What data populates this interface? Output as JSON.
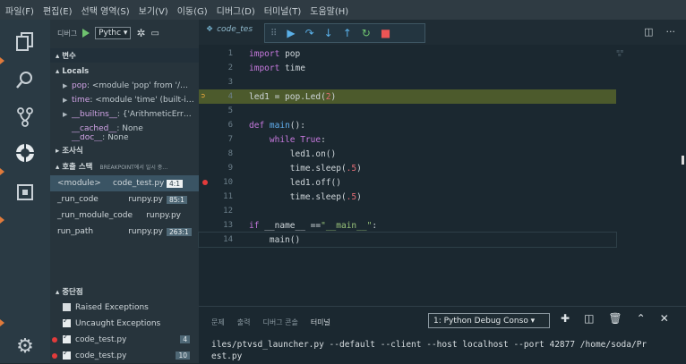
{
  "menubar": [
    "파일(F)",
    "편집(E)",
    "선택 영역(S)",
    "보기(V)",
    "이동(G)",
    "디버그(D)",
    "터미널(T)",
    "도움말(H)"
  ],
  "activity": {
    "icons": [
      "files-icon",
      "search-icon",
      "source-control-icon",
      "debug-icon",
      "extensions-icon",
      "settings-gear-icon"
    ]
  },
  "debug": {
    "label": "디버그",
    "config_select": "Pythc ▾"
  },
  "sections": {
    "variables": "▴ 변수",
    "locals": "▴ Locals",
    "watch": "▸ 조사식",
    "callstack": "▴ 호출 스택",
    "callstack_note": "BREAKPOINT에서 일시 중…",
    "breakpoints": "▴ 중단점"
  },
  "locals": [
    {
      "name": "pop",
      "value": ": <module 'pop' from '/…"
    },
    {
      "name": "time",
      "value": ": <module 'time' (built-i…"
    },
    {
      "name": "__builtins__",
      "value": ": {'ArithmeticErr…"
    },
    {
      "name": "__cached__",
      "value": ": None"
    },
    {
      "name": "__doc__",
      "value": ": None"
    }
  ],
  "callstack": [
    {
      "fn": "<module>",
      "file": "code_test.py",
      "line": "4:1"
    },
    {
      "fn": "_run_code",
      "file": "runpy.py",
      "line": "85:1"
    },
    {
      "fn": "_run_module_code",
      "file": "runpy.py",
      "line": ""
    },
    {
      "fn": "run_path",
      "file": "runpy.py",
      "line": "263:1"
    }
  ],
  "breakpoints": [
    {
      "label": "Raised Exceptions",
      "checked": false,
      "count": ""
    },
    {
      "label": "Uncaught Exceptions",
      "checked": true,
      "count": ""
    },
    {
      "label": "code_test.py",
      "checked": true,
      "count": "4"
    },
    {
      "label": "code_test.py",
      "checked": true,
      "count": "10"
    }
  ],
  "editor": {
    "tab": "code_tes",
    "lines": [
      "1",
      "2",
      "3",
      "4",
      "5",
      "6",
      "7",
      "8",
      "9",
      "10",
      "11",
      "12",
      "13",
      "14"
    ]
  },
  "panel": {
    "tabs": [
      "문제",
      "출력",
      "디버그 콘솔",
      "터미널"
    ],
    "terminal_select": "1: Python Debug Conso ▾",
    "terminal_text": "iles/ptvsd_launcher.py --default --client --host localhost --port 42877 /home/soda/Pr\nest.py"
  },
  "colors": {
    "current_line": "#4c5a2c",
    "breakpoint": "#e23b3b",
    "accent_orange": "#e07a3b"
  }
}
